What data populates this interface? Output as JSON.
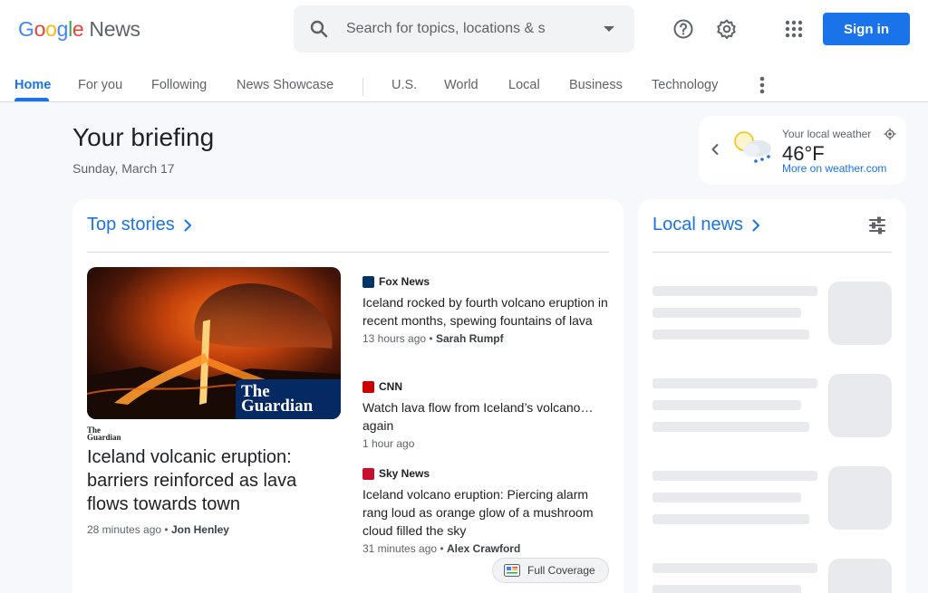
{
  "header": {
    "logo_parts": [
      "G",
      "o",
      "o",
      "g",
      "l",
      "e"
    ],
    "logo_suffix": "News",
    "search_placeholder": "Search for topics, locations & s",
    "signin_label": "Sign in",
    "icons": [
      "search-icon",
      "help-icon",
      "settings-icon",
      "apps-grid-icon"
    ]
  },
  "nav": {
    "tabs": [
      {
        "label": "Home",
        "active": true
      },
      {
        "label": "For you"
      },
      {
        "label": "Following"
      },
      {
        "label": "News Showcase"
      },
      {
        "label": "U.S."
      },
      {
        "label": "World"
      },
      {
        "label": "Local"
      },
      {
        "label": "Business"
      },
      {
        "label": "Technology"
      }
    ]
  },
  "briefing": {
    "title": "Your briefing",
    "date": "Sunday, March 17"
  },
  "weather": {
    "label": "Your local weather",
    "temp": "46°F",
    "link": "More on weather.com"
  },
  "top_stories": {
    "heading": "Top stories",
    "hero": {
      "publisher_logo_line1": "The",
      "publisher_logo_line2": "Guardian",
      "title": "Iceland volcanic eruption: barriers reinforced as lava flows towards town",
      "time": "28 minutes ago",
      "author": "Jon Henley"
    },
    "stories": [
      {
        "source": "Fox News",
        "title": "Iceland rocked by fourth volcano eruption in recent months, spewing fountains of lava",
        "time": "13 hours ago",
        "author": "Sarah Rumpf",
        "color": "#003366"
      },
      {
        "source": "CNN",
        "title": "Watch lava flow from Iceland’s volcano… again",
        "time": "1 hour ago",
        "author": "",
        "color": "#cc0000"
      },
      {
        "source": "Sky News",
        "title": "Iceland volcano eruption: Piercing alarm rang loud as orange glow of a mushroom cloud filled the sky",
        "time": "31 minutes ago",
        "author": "Alex Crawford",
        "color": "#c8102e"
      }
    ],
    "full_coverage_label": "Full Coverage"
  },
  "local_news": {
    "heading": "Local news"
  }
}
